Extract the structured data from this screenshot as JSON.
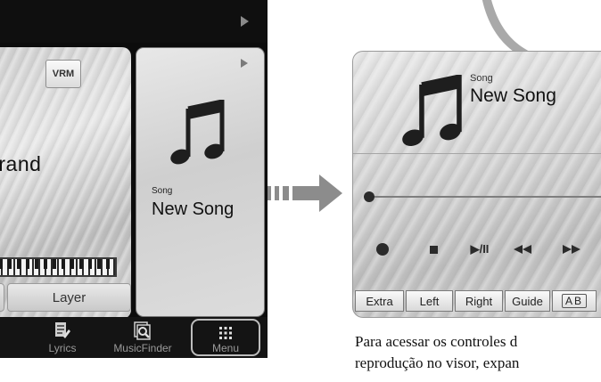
{
  "left_screen": {
    "voice_panel": {
      "vrm_label": "VRM",
      "voice_name": "Grand",
      "layer_label": "Layer"
    },
    "song_panel": {
      "label": "Song",
      "name": "New Song",
      "icon": "music-note-icon"
    },
    "bottom_bar": {
      "items": [
        {
          "label": "Lyrics",
          "icon": "lyrics-icon"
        },
        {
          "label": "MusicFinder",
          "icon": "music-finder-icon"
        },
        {
          "label": "Menu",
          "icon": "grid-menu-icon"
        }
      ]
    }
  },
  "zoom_panel": {
    "song_label": "Song",
    "song_name": "New Song",
    "progress": 0.0,
    "controls": {
      "rec": "record-icon",
      "stop": "stop-icon",
      "play_pause": "▶/II",
      "rewind": "rewind-icon",
      "fast_forward": "fast-forward-icon"
    },
    "buttons": {
      "extra": "Extra",
      "left": "Left",
      "right": "Right",
      "guide": "Guide",
      "ab": "AB"
    }
  },
  "caption": {
    "line1": "Para acessar os controles d",
    "line2": "reprodução no visor, expan"
  },
  "colors": {
    "screen_bg": "#0c0c0c",
    "panel_gray": "#d6d6d6",
    "arrow_gray": "#8c8c8c"
  }
}
